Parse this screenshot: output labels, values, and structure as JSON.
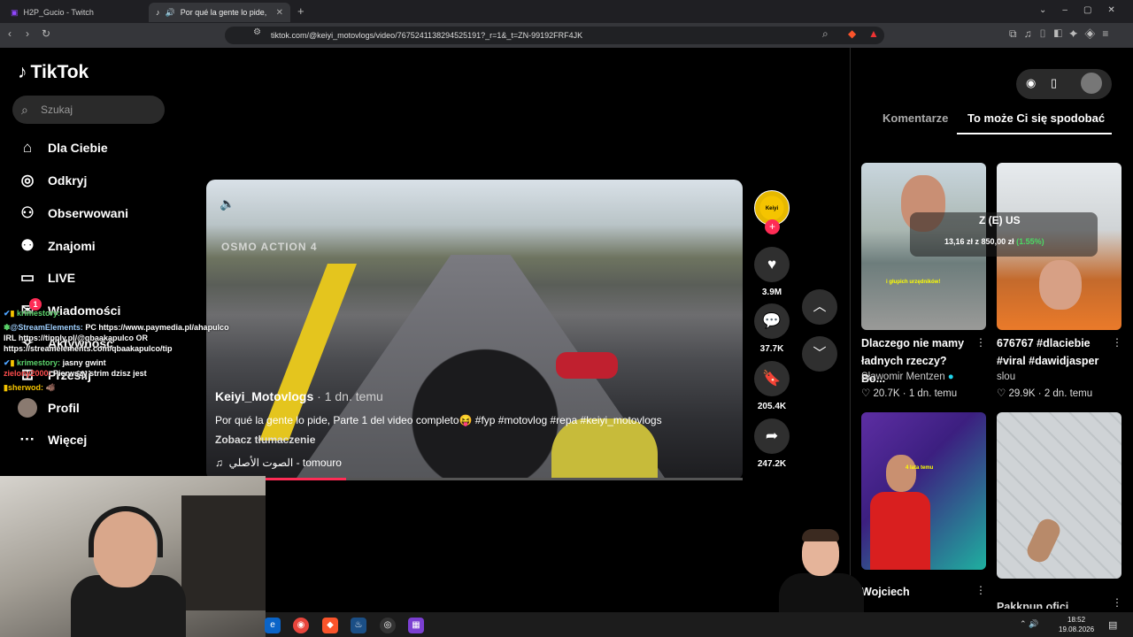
{
  "browser": {
    "tabs": [
      {
        "title": "H2P_Gucio - Twitch"
      },
      {
        "title": "Por qué la gente lo pide, Parte"
      }
    ],
    "url": "tiktok.com/@keiyi_motovlogs/video/7675241138294525191?_r=1&_t=ZN-99192FRF4JK"
  },
  "tiktok": {
    "logo": "TikTok",
    "search_placeholder": "Szukaj",
    "nav": [
      {
        "label": "Dla Ciebie",
        "icon": "home-icon"
      },
      {
        "label": "Odkryj",
        "icon": "compass-icon"
      },
      {
        "label": "Obserwowani",
        "icon": "following-icon"
      },
      {
        "label": "Znajomi",
        "icon": "friends-icon"
      },
      {
        "label": "LIVE",
        "icon": "live-tv-icon"
      },
      {
        "label": "Wiadomości",
        "icon": "messages-icon",
        "badge": "1"
      },
      {
        "label": "Aktywność",
        "icon": "activity-icon"
      },
      {
        "label": "Prześlij",
        "icon": "upload-icon"
      },
      {
        "label": "Profil",
        "icon": "profile-avatar"
      },
      {
        "label": "Więcej",
        "icon": "more-icon"
      }
    ],
    "video": {
      "watermark": "OSMO ACTION 4",
      "author": "Keiyi_Motovlogs",
      "time": " · 1 dn. temu",
      "description": "Por qué la gente lo pide, Parte 1 del video completo😝 #fyp #motovlog #repa #keiyi_motovlogs",
      "translate": "Zobacz tłumaczenie",
      "music": "الصوت الأصلي - tomouro",
      "progress_percent": 26
    },
    "actions": {
      "avatar_text": "Keiyi Motovlogs",
      "likes": "3.9M",
      "comments": "37.7K",
      "saves": "205.4K",
      "shares": "247.2K"
    },
    "right_tabs": [
      "Komentarze",
      "To może Ci się spodobać"
    ],
    "cards": [
      {
        "title": "Dlaczego nie mamy ładnych rzeczy? Bo...",
        "author": "Sławomir Mentzen",
        "verified": true,
        "likes": "20.7K",
        "date": "1 dn. temu",
        "caption": "i głupich urzędników!"
      },
      {
        "title": "676767 #dlaciebie #viral #dawidjasper",
        "author": "slou",
        "likes": "29.9K",
        "date": "2 dn. temu"
      },
      {
        "title": "Wojciech",
        "caption": "4 lata temu"
      },
      {
        "title": "Pakkpun ofici..."
      }
    ]
  },
  "stream_overlay": {
    "stock_name": "Z (E) US",
    "stock_value": "13,16 zł",
    "stock_from": "z 850,00 zł",
    "stock_change": "(1.55%)",
    "chat": [
      {
        "user": "krimestory:",
        "text": ""
      },
      {
        "user": "@StreamElements:",
        "text": "PC https://www.paymedia.pl/ahapulco IRL https://tipply.pl/@qbaakapulco OR https://streamelements.com/qbaakapulco/tip"
      },
      {
        "user": "krimestory:",
        "text": "jasny gwint"
      },
      {
        "user": "zielony2000:",
        "text": "Pierwszy strim dzisz jest"
      },
      {
        "user": "sherwod:",
        "text": "🐗"
      }
    ]
  },
  "taskbar": {
    "time": "18:52",
    "date": "19.08.2026"
  }
}
